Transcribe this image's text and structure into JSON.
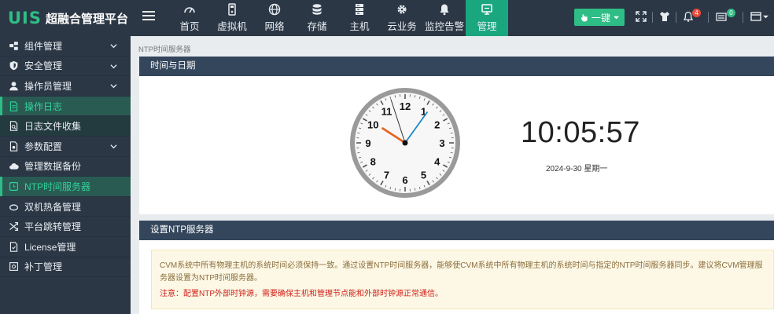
{
  "app": {
    "logo_mark": "UIS",
    "title": "超融合管理平台"
  },
  "nav": {
    "items": [
      {
        "label": "首页",
        "icon": "dashboard-icon"
      },
      {
        "label": "虚拟机",
        "icon": "vm-icon"
      },
      {
        "label": "网络",
        "icon": "globe-icon"
      },
      {
        "label": "存储",
        "icon": "database-icon"
      },
      {
        "label": "主机",
        "icon": "server-icon"
      },
      {
        "label": "云业务",
        "icon": "gear-icon"
      },
      {
        "label": "监控告警",
        "icon": "bell-icon"
      },
      {
        "label": "管理",
        "icon": "monitor-icon"
      }
    ],
    "active": "管理"
  },
  "toolbar": {
    "onekey_label": "一键",
    "alerts_count": "4",
    "tasks_count": "0"
  },
  "colors": {
    "topbar": "#2c3745",
    "accent": "#1aa77f",
    "panel_header": "#34465c",
    "warning_text": "#d0221a"
  },
  "sidebar": {
    "items": [
      {
        "label": "组件管理",
        "icon": "components-icon",
        "expandable": true
      },
      {
        "label": "安全管理",
        "icon": "shield-icon",
        "expandable": true
      },
      {
        "label": "操作员管理",
        "icon": "user-icon",
        "expandable": true
      },
      {
        "label": "操作日志",
        "icon": "doc-icon",
        "sub": true,
        "current": true
      },
      {
        "label": "日志文件收集",
        "icon": "doc-search-icon",
        "sub": true
      },
      {
        "label": "参数配置",
        "icon": "settings-doc-icon",
        "expandable": true
      },
      {
        "label": "管理数据备份",
        "icon": "cloud-icon"
      },
      {
        "label": "NTP时间服务器",
        "icon": "clock-icon",
        "highlight": true
      },
      {
        "label": "双机热备管理",
        "icon": "sync-icon"
      },
      {
        "label": "平台跳转管理",
        "icon": "shuffle-icon"
      },
      {
        "label": "License管理",
        "icon": "license-icon"
      },
      {
        "label": "补丁管理",
        "icon": "patch-icon"
      }
    ]
  },
  "page": {
    "breadcrumb": "NTP时间服务器",
    "time_panel_title": "时间与日期",
    "clock": {
      "hour": 10,
      "minute": 5,
      "second": 57,
      "numbers": [
        "12",
        "1",
        "2",
        "3",
        "4",
        "5",
        "6",
        "7",
        "8",
        "9",
        "10",
        "11"
      ]
    },
    "digital_time": "10:05:57",
    "date_text": "2024-9-30 星期一",
    "ntp_panel_title": "设置NTP服务器",
    "notice_text": "CVM系统中所有物理主机的系统时间必须保持一致。通过设置NTP时间服务器，能够使CVM系统中所有物理主机的系统时间与指定的NTP时间服务器同步。建议将CVM管理服务器设置为NTP时间服务器。",
    "warning_text": "注意：配置NTP外部时钟源，需要确保主机和管理节点能和外部时钟源正常通信。"
  }
}
